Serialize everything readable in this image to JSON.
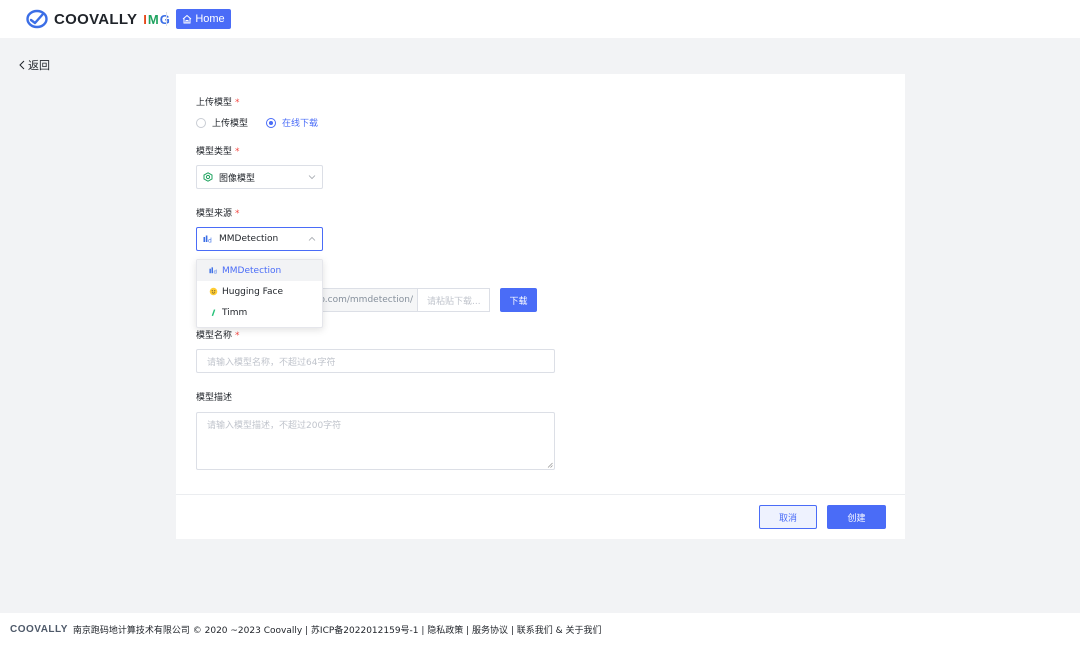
{
  "header": {
    "brand": "COOVALLY",
    "brand_suffix": [
      "I",
      "M",
      "G"
    ],
    "home_label": "Home",
    "colors": {
      "accent": "#4a6cf7",
      "logo_blue": "#3b6ee6"
    }
  },
  "back_label": "返回",
  "form": {
    "upload_label": "上传模型",
    "upload_options": [
      "上传模型",
      "在线下载"
    ],
    "model_type_label": "模型类型",
    "model_type_value": "图像模型",
    "model_source_label": "模型来源",
    "model_source_value": "MMDetection",
    "source_options": [
      {
        "label": "MMDetection",
        "icon": "mmdetection-icon",
        "selected": true
      },
      {
        "label": "Hugging Face",
        "icon": "hugging-face-icon",
        "selected": false
      },
      {
        "label": "Timm",
        "icon": "timm-icon",
        "selected": false
      }
    ],
    "url_prefix": "o.com/mmdetection/",
    "url_placeholder": "请粘贴下载...",
    "download_label": "下载",
    "model_name_label": "模型名称",
    "model_name_placeholder": "请输入模型名称，不超过64字符",
    "model_desc_label": "模型描述",
    "model_desc_placeholder": "请输入模型描述，不超过200字符",
    "required_mark": "*"
  },
  "actions": {
    "cancel": "取消",
    "create": "创建"
  },
  "footer": {
    "brand": "COOVALLY",
    "text": "南京跑码地计算技术有限公司 © 2020 ~2023 Coovally | 苏ICP备2022012159号-1 | 隐私政策 | 服务协议 | 联系我们 & 关于我们"
  }
}
